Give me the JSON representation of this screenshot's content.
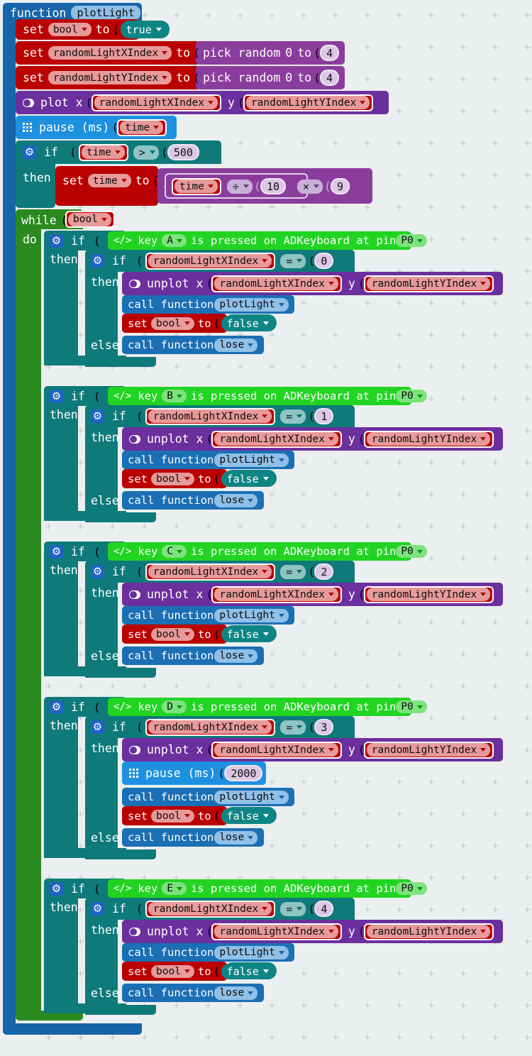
{
  "editor": {
    "background_color": "#ecefef",
    "grid_marker": "+"
  },
  "program": {
    "function": {
      "keyword": "function",
      "name": "plotLight",
      "color": "#1565a8"
    },
    "statements": [
      {
        "type": "variables_set",
        "keyword": "set",
        "variable": "bool",
        "to": "to",
        "value": "true",
        "value_kind": "boolean",
        "color": "#bb0000"
      },
      {
        "type": "variables_set",
        "keyword": "set",
        "variable": "randomLightXIndex",
        "to": "to",
        "value_kind": "pick_random",
        "pick_random": {
          "label_a": "pick random",
          "from": "0",
          "label_b": "to",
          "to": "4"
        },
        "color": "#bb0000"
      },
      {
        "type": "variables_set",
        "keyword": "set",
        "variable": "randomLightYIndex",
        "to": "to",
        "value_kind": "pick_random",
        "pick_random": {
          "label_a": "pick random",
          "from": "0",
          "label_b": "to",
          "to": "4"
        },
        "color": "#bb0000"
      },
      {
        "type": "led_plot",
        "keyword": "plot x",
        "x_var": "randomLightXIndex",
        "y_label": "y",
        "y_var": "randomLightYIndex",
        "icon": "led-icon",
        "color": "#6b2f9e"
      },
      {
        "type": "basic_pause",
        "keyword": "pause (ms)",
        "value_kind": "variable",
        "value": "time",
        "icon": "grid-dots-icon",
        "color": "#1e90e0"
      },
      {
        "type": "controls_if",
        "keyword": "if",
        "then": "then",
        "icon": "gear-icon",
        "condition": {
          "left_var": "time",
          "operator": ">",
          "right": "500"
        },
        "body": {
          "keyword": "set",
          "variable": "time",
          "to": "to",
          "math": {
            "inner": {
              "left_var": "time",
              "operator": "÷",
              "right": "10"
            },
            "operator": "×",
            "right": "9"
          }
        },
        "color": "#0e7a7a"
      },
      {
        "type": "controls_while",
        "keyword": "while",
        "do": "do",
        "condition_var": "bool",
        "color": "#2a8a20"
      }
    ],
    "key_branches": [
      {
        "key": "A",
        "index": "0",
        "has_extra_pause": false,
        "pause_value": ""
      },
      {
        "key": "B",
        "index": "1",
        "has_extra_pause": false,
        "pause_value": ""
      },
      {
        "key": "C",
        "index": "2",
        "has_extra_pause": false,
        "pause_value": ""
      },
      {
        "key": "D",
        "index": "3",
        "has_extra_pause": true,
        "pause_value": "2000"
      },
      {
        "key": "E",
        "index": "4",
        "has_extra_pause": false,
        "pause_value": ""
      }
    ],
    "branch_template": {
      "if": "if",
      "then": "then",
      "else": "else",
      "icon": "gear-icon",
      "key_block": {
        "icon": "code-icon",
        "label_a": "key",
        "label_b": "is pressed on ADKeyboard at pin",
        "pin": "P0",
        "color": "#22d422"
      },
      "compare": {
        "var": "randomLightXIndex",
        "operator": "="
      },
      "unplot": {
        "keyword": "unplot x",
        "x_var": "randomLightXIndex",
        "y_label": "y",
        "y_var": "randomLightYIndex",
        "icon": "led-icon",
        "color": "#6b2f9e"
      },
      "pause": {
        "keyword": "pause (ms)",
        "icon": "grid-dots-icon",
        "color": "#1e90e0"
      },
      "call_then": {
        "keyword": "call function",
        "name": "plotLight",
        "color": "#1b6fb5"
      },
      "set_bool": {
        "keyword": "set",
        "variable": "bool",
        "to": "to",
        "value": "false",
        "color": "#bb0000"
      },
      "call_else": {
        "keyword": "call function",
        "name": "lose",
        "color": "#1b6fb5"
      }
    }
  }
}
